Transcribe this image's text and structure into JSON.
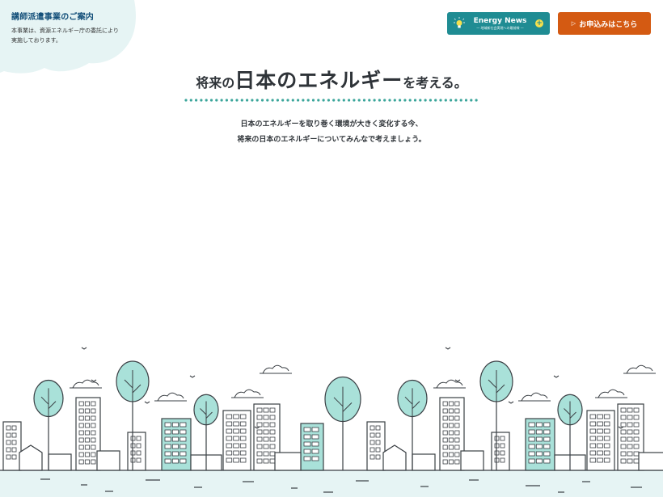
{
  "corner": {
    "title": "講師派遣事業のご案内",
    "desc_line1": "本事業は、資源エネルギー庁の委託により",
    "desc_line2": "実施しております。"
  },
  "energy_news": {
    "title": "Energy News",
    "subtitle": "— 地域新社会実現への最前線 —",
    "icon": "lightbulb-icon"
  },
  "apply": {
    "label": "お申込みはこちら",
    "icon": "play-icon"
  },
  "headline": {
    "part1": "将来の",
    "part2": "日本のエネルギー",
    "part3": "を考える。"
  },
  "lead": {
    "line1": "日本のエネルギーを取り巻く環境が大きく変化する今、",
    "line2": "将来の日本のエネルギーについてみんなで考えましょう。"
  },
  "colors": {
    "navy": "#14507a",
    "teal": "#1f8c93",
    "orange": "#d45a12",
    "mint": "#a9e1d9",
    "ink": "#2e3338",
    "blob": "#e6f4f4"
  }
}
